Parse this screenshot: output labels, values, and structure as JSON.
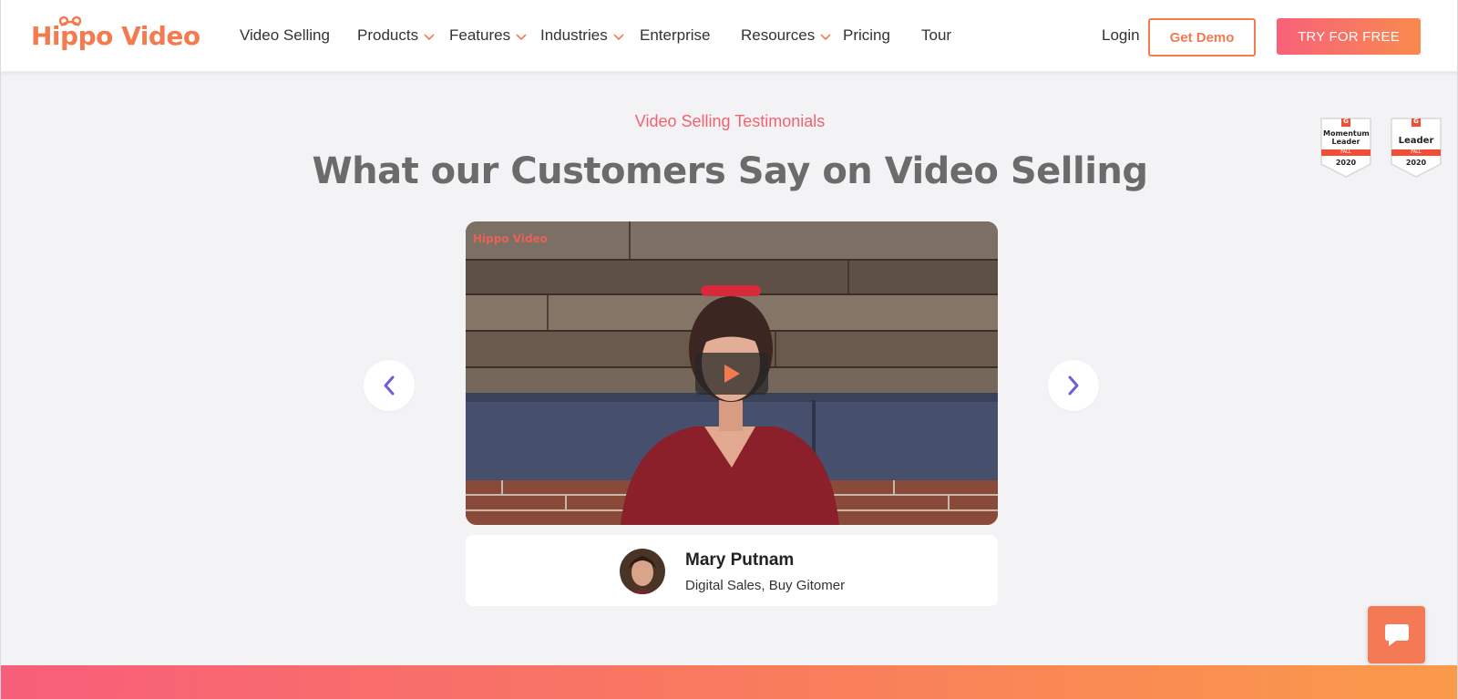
{
  "brand": {
    "logo_text": "Hippo Video",
    "accent": "#f47a4f",
    "cta_gradient": [
      "#f7617a",
      "#f98a4e"
    ]
  },
  "nav": {
    "items": [
      {
        "label": "Video Selling",
        "dropdown": false
      },
      {
        "label": "Products",
        "dropdown": true
      },
      {
        "label": "Features",
        "dropdown": true
      },
      {
        "label": "Industries",
        "dropdown": true
      },
      {
        "label": "Enterprise",
        "dropdown": false
      },
      {
        "label": "Resources",
        "dropdown": true
      },
      {
        "label": "Pricing",
        "dropdown": false
      },
      {
        "label": "Tour",
        "dropdown": false
      }
    ],
    "login": "Login",
    "get_demo": "Get Demo",
    "try_free": "TRY FOR FREE"
  },
  "badges": [
    {
      "brand": "G",
      "title": "Momentum Leader",
      "season": "FALL",
      "year": "2020"
    },
    {
      "brand": "G",
      "title": "Leader",
      "season": "FALL",
      "year": "2020"
    }
  ],
  "hero": {
    "eyebrow": "Video Selling Testimonials",
    "headline": "What our Customers Say on Video Selling"
  },
  "video": {
    "watermark": "Hippo Video",
    "play_icon": "play-icon"
  },
  "testimonial": {
    "name": "Mary Putnam",
    "role": "Digital Sales, Buy Gitomer"
  },
  "controls": {
    "prev_icon": "chevron-left-icon",
    "next_icon": "chevron-right-icon",
    "chat_icon": "chat-bubble-icon"
  }
}
